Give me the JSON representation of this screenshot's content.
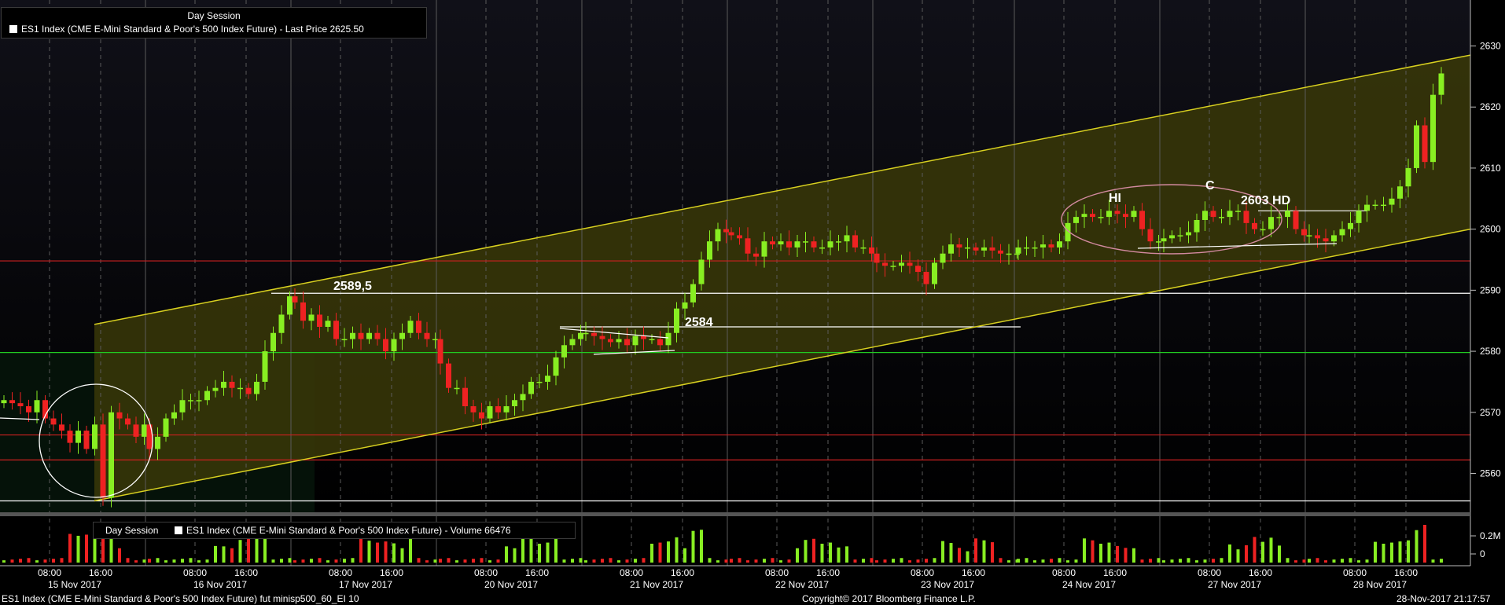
{
  "legend": {
    "session": "Day Session",
    "price_series": "ES1 Index (CME E-Mini Standard & Poor's 500 Index Future) - Last Price 2625.50",
    "volume_session": "Day Session",
    "volume_series": "ES1 Index (CME E-Mini Standard & Poor's 500 Index Future) - Volume 66476"
  },
  "footer": {
    "left": "ES1 Index (CME E-Mini Standard & Poor's 500 Index Future) fut minisp500_60_EI 10",
    "center": "Copyright© 2017 Bloomberg Finance L.P.",
    "right": "28-Nov-2017 21:17:57"
  },
  "colors": {
    "up": "#88ee22",
    "down": "#ee2222",
    "channel": "#d8d020",
    "support_green": "#22cc22",
    "support_red": "#cc2020",
    "grid": "#5a5a5a"
  },
  "chart_data": {
    "type": "candlestick",
    "interval": "60 min",
    "y_axis": {
      "ticks": [
        2560,
        2570,
        2580,
        2590,
        2600,
        2610,
        2620,
        2630
      ],
      "ylim": [
        2555,
        2638
      ],
      "side": "right"
    },
    "volume_axis": {
      "ticks": [
        "0.2M",
        "0"
      ]
    },
    "days": [
      {
        "date": "15 Nov 2017",
        "times": [
          "08:00",
          "16:00"
        ]
      },
      {
        "date": "16 Nov 2017",
        "times": [
          "08:00",
          "16:00"
        ]
      },
      {
        "date": "17 Nov 2017",
        "times": [
          "08:00",
          "16:00"
        ]
      },
      {
        "date": "20 Nov 2017",
        "times": [
          "08:00",
          "16:00"
        ]
      },
      {
        "date": "21 Nov 2017",
        "times": [
          "08:00",
          "16:00"
        ]
      },
      {
        "date": "22 Nov 2017",
        "times": [
          "08:00",
          "16:00"
        ]
      },
      {
        "date": "23 Nov 2017",
        "times": [
          "08:00",
          "16:00"
        ]
      },
      {
        "date": "24 Nov 2017",
        "times": [
          "08:00",
          "16:00"
        ]
      },
      {
        "date": "27 Nov 2017",
        "times": [
          "08:00",
          "16:00"
        ]
      },
      {
        "date": "28 Nov 2017",
        "times": [
          "08:00",
          "16:00"
        ]
      }
    ],
    "horizontal_levels": [
      {
        "value": 2589.5,
        "color": "white"
      },
      {
        "value": 2584,
        "color": "white"
      },
      {
        "value": 2603,
        "color": "white"
      },
      {
        "value": 2555.5,
        "color": "white"
      },
      {
        "value": 2594.8,
        "color": "red"
      },
      {
        "value": 2579.8,
        "color": "green"
      },
      {
        "value": 2566.3,
        "color": "red"
      },
      {
        "value": 2562.2,
        "color": "red"
      }
    ],
    "annotations": [
      "2589,5",
      "2584",
      "HI",
      "C",
      "2603 HD"
    ],
    "channel": {
      "lower": [
        [
          2555.5,
          2600.0
        ]
      ],
      "upper": [
        [
          2584.4,
          2628.5
        ]
      ]
    },
    "last_price": 2625.5,
    "last_volume": 66476,
    "closes": [
      2572,
      2571.5,
      2571,
      2570,
      2572,
      2569,
      2568,
      2567,
      2565,
      2567,
      2564,
      2568,
      2556,
      2570,
      2569,
      2568,
      2566,
      2568,
      2564,
      2566,
      2569,
      2570,
      2572,
      2572,
      2572,
      2573.5,
      2574,
      2575,
      2574,
      2574,
      2573,
      2575,
      2580,
      2583,
      2586,
      2589,
      2588,
      2585,
      2586,
      2584,
      2585,
      2582,
      2582,
      2583,
      2582,
      2583,
      2582,
      2580,
      2582,
      2583,
      2585,
      2583,
      2582,
      2582,
      2578,
      2574,
      2574,
      2571,
      2570,
      2569,
      2571,
      2570,
      2571,
      2572,
      2573,
      2575,
      2575,
      2576,
      2579,
      2581,
      2582,
      2583,
      2583,
      2582.5,
      2582,
      2581.5,
      2582,
      2581,
      2582.5,
      2582,
      2582,
      2581,
      2583,
      2587,
      2588,
      2591,
      2595,
      2598,
      2600,
      2599.5,
      2599,
      2598.5,
      2596,
      2595.5,
      2598,
      2597.5,
      2598,
      2597,
      2598,
      2598,
      2597,
      2597,
      2598,
      2598,
      2599,
      2597,
      2597,
      2596,
      2594.5,
      2594,
      2594,
      2594.5,
      2594,
      2593,
      2591,
      2594.5,
      2596,
      2597.5,
      2597,
      2597,
      2596.5,
      2597,
      2596.5,
      2596,
      2596,
      2596,
      2597,
      2597,
      2597,
      2597.5,
      2597,
      2598,
      2601,
      2602,
      2602.5,
      2602,
      2602,
      2603,
      2602.5,
      2602,
      2603,
      2600,
      2598,
      2598,
      2598.5,
      2599,
      2599,
      2599.5,
      2601.5,
      2603,
      2602,
      2602,
      2603,
      2603,
      2601,
      2600,
      2600,
      2602,
      2602,
      2603,
      2600,
      2599,
      2599,
      2598.5,
      2598,
      2599,
      2600,
      2601,
      2603,
      2604,
      2604,
      2604,
      2605,
      2607,
      2610,
      2617,
      2611,
      2622,
      2625.5
    ]
  }
}
